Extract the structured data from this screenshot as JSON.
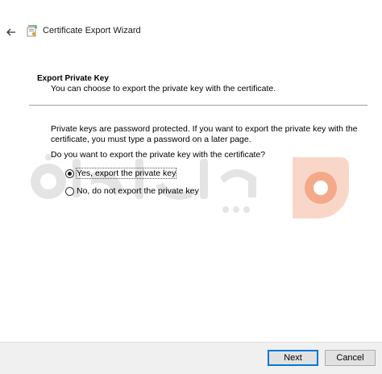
{
  "window": {
    "title": "Certificate Export Wizard",
    "back_icon": "back-arrow-icon",
    "wizard_icon": "certificate-wizard-icon"
  },
  "header": {
    "heading": "Export Private Key",
    "subtitle": "You can choose to export the private key with the certificate."
  },
  "content": {
    "paragraph": "Private keys are password protected. If you want to export the private key with the certificate, you must type a password on a later page.",
    "question": "Do you want to export the private key with the certificate?",
    "options": [
      {
        "label": "Yes, export the private key",
        "selected": true
      },
      {
        "label": "No, do not export the private key",
        "selected": false
      }
    ]
  },
  "footer": {
    "next_label": "Next",
    "cancel_label": "Cancel"
  },
  "colors": {
    "accent": "#0078d7",
    "watermark_gray": "#e6e6e6",
    "watermark_orange": "#f7c6b0"
  }
}
